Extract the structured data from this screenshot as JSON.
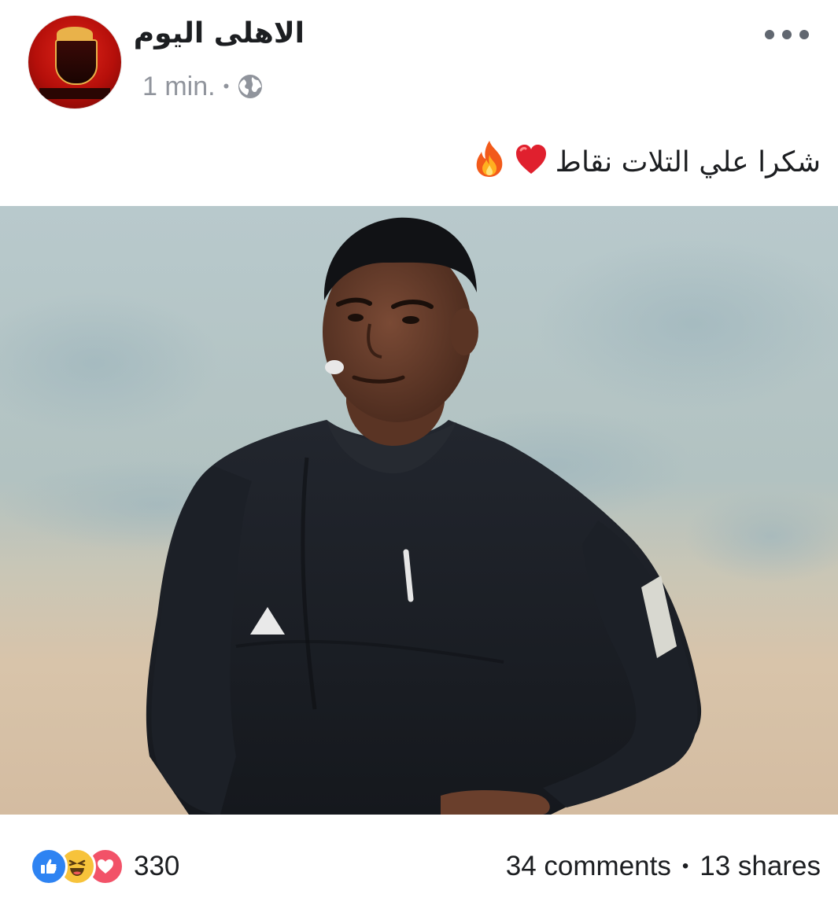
{
  "post": {
    "page_name": "الاهلى اليوم",
    "timestamp": "1 min.",
    "meta_separator": "•",
    "privacy_icon": "globe-icon",
    "more_icon": "more-options-icon",
    "caption_text": "شكرا علي التلات نقاط",
    "caption_emojis": [
      "heart-emoji",
      "fire-emoji"
    ],
    "image_icon": "referee-photo"
  },
  "footer": {
    "reaction_icons": [
      "like-icon",
      "haha-icon",
      "love-icon"
    ],
    "reaction_count": "330",
    "comments": "34 comments",
    "separator": "•",
    "shares": "13 shares"
  },
  "colors": {
    "meta_gray": "#90949c",
    "like_blue": "#2e83f2",
    "haha_yellow": "#f7c33b",
    "love_red": "#f25268",
    "avatar_red": "#e2261b"
  }
}
